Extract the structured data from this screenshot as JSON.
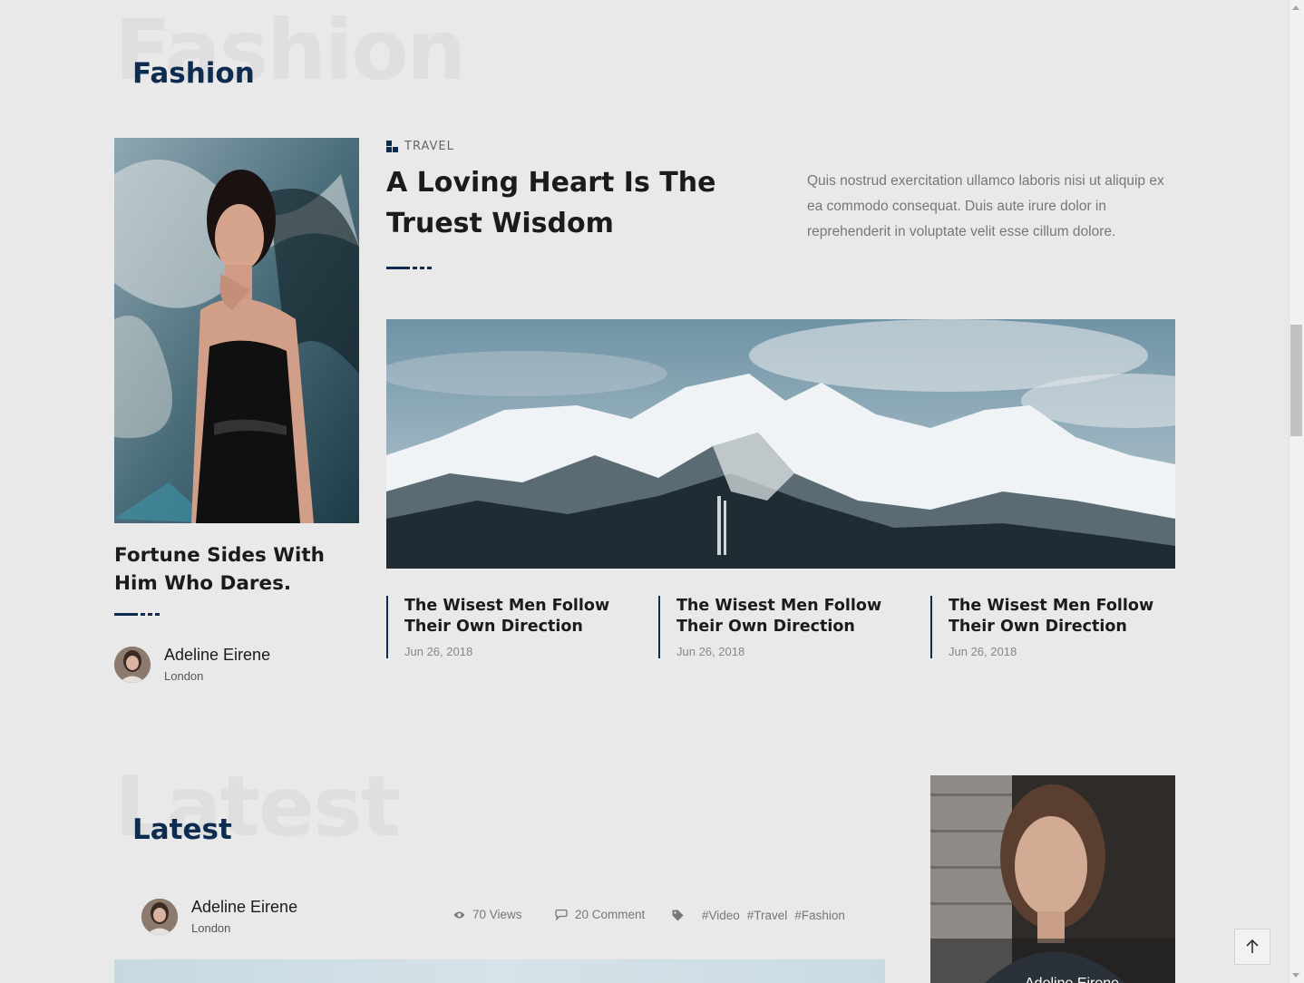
{
  "fashion_section": {
    "bg_word": "Fashion",
    "title": "Fashion",
    "side_post": {
      "title": "Fortune Sides With Him Who Dares.",
      "author": {
        "name": "Adeline Eirene",
        "location": "London"
      }
    },
    "featured_post": {
      "category": "TRAVEL",
      "title": "A Loving Heart Is The Truest Wisdom",
      "excerpt": "Quis nostrud exercitation ullamco laboris nisi ut aliquip ex ea commodo consequat. Duis aute irure dolor in reprehenderit in voluptate velit esse cillum dolore."
    },
    "cards": [
      {
        "title": "The Wisest Men Follow Their Own Direction",
        "date": "Jun 26, 2018"
      },
      {
        "title": "The Wisest Men Follow Their Own Direction",
        "date": "Jun 26, 2018"
      },
      {
        "title": "The Wisest Men Follow Their Own Direction",
        "date": "Jun 26, 2018"
      }
    ]
  },
  "latest_section": {
    "bg_word": "Latest",
    "title": "Latest",
    "post": {
      "author": {
        "name": "Adeline Eirene",
        "location": "London"
      },
      "views": "70 Views",
      "comments": "20 Comment",
      "tags": [
        "#Video",
        "#Travel",
        "#Fashion"
      ]
    },
    "sidebar_author": "Adeline Eirene"
  },
  "icons": {
    "category": "category-icon",
    "views": "eye-icon",
    "comments": "comment-icon",
    "tags": "tag-icon",
    "back_to_top": "arrow-up-icon"
  },
  "colors": {
    "background": "#e9e9e9",
    "accent": "#0d2c4f",
    "text": "#1b1b1b",
    "muted": "#777777",
    "bg_word": "#dfdfdf"
  }
}
